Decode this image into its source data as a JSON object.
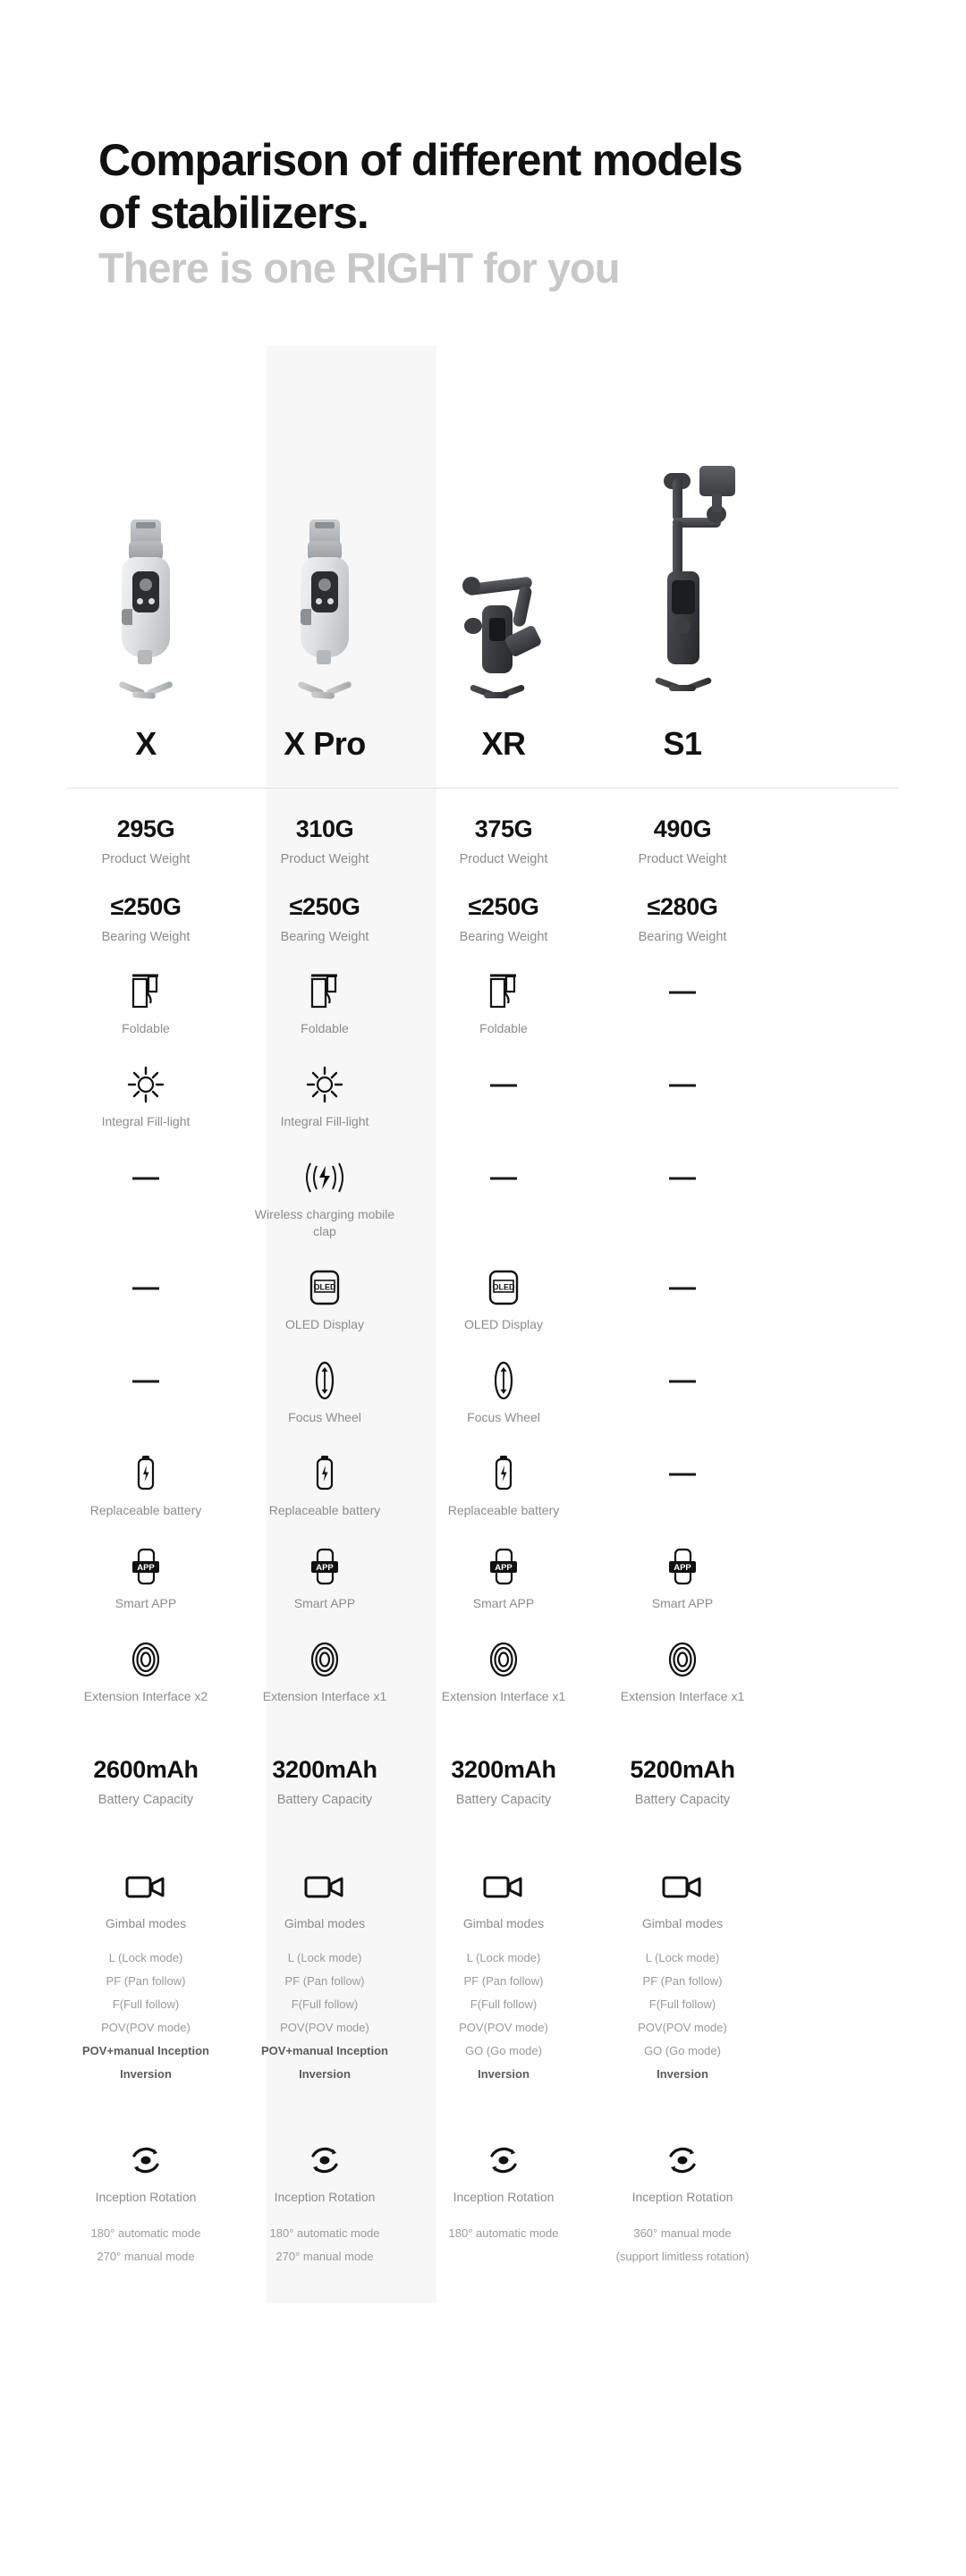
{
  "header": {
    "title_line1": "Comparison of different models",
    "title_line2": "of stabilizers.",
    "subtitle": "There is one RIGHT for you"
  },
  "columns": [
    {
      "name": "X",
      "product_icon": "gimbal-silver-compact",
      "highlight": false
    },
    {
      "name": "X Pro",
      "product_icon": "gimbal-silver-compact",
      "highlight": true
    },
    {
      "name": "XR",
      "product_icon": "gimbal-black-folded",
      "highlight": false
    },
    {
      "name": "S1",
      "product_icon": "gimbal-black-tall",
      "highlight": false
    }
  ],
  "rows": {
    "product_weight": {
      "label": "Product Weight",
      "values": [
        "295G",
        "310G",
        "375G",
        "490G"
      ]
    },
    "bearing_weight": {
      "label": "Bearing Weight",
      "values": [
        "≤250G",
        "≤250G",
        "≤250G",
        "≤280G"
      ]
    },
    "foldable": {
      "label": "Foldable",
      "icon": "foldable-icon",
      "present": [
        true,
        true,
        true,
        false
      ]
    },
    "fill_light": {
      "label": "Integral Fill-light",
      "icon": "sun-icon",
      "present": [
        true,
        true,
        false,
        false
      ]
    },
    "wireless_charging": {
      "label": "Wireless charging mobile clap",
      "icon": "wireless-charging-icon",
      "present": [
        false,
        true,
        false,
        false
      ]
    },
    "oled_display": {
      "label": "OLED Display",
      "icon": "oled-screen-icon",
      "badge": "OLED",
      "present": [
        false,
        true,
        true,
        false
      ]
    },
    "focus_wheel": {
      "label": "Focus Wheel",
      "icon": "focus-wheel-icon",
      "present": [
        false,
        true,
        true,
        false
      ]
    },
    "replaceable_battery": {
      "label": "Replaceable battery",
      "icon": "battery-bolt-icon",
      "present": [
        true,
        true,
        true,
        false
      ]
    },
    "smart_app": {
      "label": "Smart APP",
      "icon": "phone-app-icon",
      "badge": "APP",
      "present": [
        true,
        true,
        true,
        true
      ]
    },
    "extension_interface": {
      "icon": "extension-interface-icon",
      "labels": [
        "Extension Interface x2",
        "Extension Interface x1",
        "Extension Interface x1",
        "Extension Interface x1"
      ]
    },
    "battery_capacity": {
      "label": "Battery Capacity",
      "values": [
        "2600mAh",
        "3200mAh",
        "3200mAh",
        "5200mAh"
      ]
    },
    "gimbal_modes": {
      "label": "Gimbal modes",
      "icon": "camcorder-icon",
      "lists": [
        [
          "L (Lock mode)",
          "PF (Pan follow)",
          "F(Full follow)",
          "POV(POV mode)",
          "POV+manual Inception",
          "Inversion"
        ],
        [
          "L (Lock mode)",
          "PF (Pan follow)",
          "F(Full follow)",
          "POV(POV mode)",
          "POV+manual Inception",
          "Inversion"
        ],
        [
          "L (Lock mode)",
          "PF (Pan follow)",
          "F(Full follow)",
          "POV(POV mode)",
          "GO (Go mode)",
          "Inversion"
        ],
        [
          "L (Lock mode)",
          "PF (Pan follow)",
          "F(Full follow)",
          "POV(POV mode)",
          "GO (Go mode)",
          "Inversion"
        ]
      ]
    },
    "inception_rotation": {
      "label": "Inception Rotation",
      "icon": "rotation-icon",
      "details": [
        [
          "180° automatic mode",
          "270° manual mode"
        ],
        [
          "180° automatic mode",
          "270° manual mode"
        ],
        [
          "180° automatic mode",
          ""
        ],
        [
          "360° manual mode",
          "(support limitless rotation)"
        ]
      ]
    }
  },
  "colors": {
    "text": "#111111",
    "muted": "#8c8c8c",
    "subtitle": "#c8c8c8",
    "highlight_bg": "#f7f7f7",
    "divider": "#e2e2e2"
  }
}
